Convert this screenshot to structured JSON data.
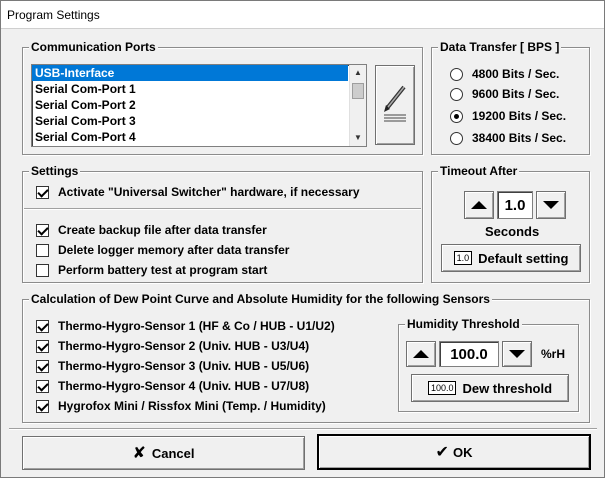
{
  "window": {
    "title": "Program Settings"
  },
  "ports": {
    "legend": "Communication Ports",
    "items": [
      "USB-Interface",
      "Serial Com-Port 1",
      "Serial Com-Port 2",
      "Serial Com-Port 3",
      "Serial Com-Port 4"
    ],
    "selected_index": 0
  },
  "transfer": {
    "legend": "Data Transfer [ BPS ]",
    "options": [
      "4800 Bits / Sec.",
      "9600 Bits / Sec.",
      "19200 Bits / Sec.",
      "38400 Bits / Sec."
    ],
    "selected": "19200 Bits / Sec."
  },
  "settings": {
    "legend": "Settings",
    "activate_switcher": "Activate \"Universal Switcher\" hardware, if necessary",
    "backup": "Create backup file after data transfer",
    "delete_memory": "Delete logger memory after data transfer",
    "battery_test": "Perform battery test at program start"
  },
  "timeout": {
    "legend": "Timeout After",
    "value": "1.0",
    "unit": "Seconds",
    "default_tag": "1.0",
    "default_label": "Default setting"
  },
  "dew": {
    "legend": "Calculation of Dew Point Curve and Absolute Humidity for the following Sensors",
    "sensors": [
      "Thermo-Hygro-Sensor 1 (HF & Co / HUB - U1/U2)",
      "Thermo-Hygro-Sensor 2 (Univ. HUB - U3/U4)",
      "Thermo-Hygro-Sensor 3 (Univ. HUB - U5/U6)",
      "Thermo-Hygro-Sensor 4 (Univ. HUB - U7/U8)",
      "Hygrofox Mini / Rissfox Mini (Temp. / Humidity)"
    ]
  },
  "humidity": {
    "legend": "Humidity Threshold",
    "value": "100.0",
    "unit": "%rH",
    "tag": "100.0",
    "button_label": "Dew threshold"
  },
  "footer": {
    "cancel_label": "Cancel",
    "ok_label": "OK"
  },
  "colors": {
    "selection": "#0078d7",
    "background": "#f0f0f0"
  },
  "icons": {
    "edit": "pencil-icon",
    "cancel": "x-icon",
    "ok": "checkmark-icon"
  }
}
